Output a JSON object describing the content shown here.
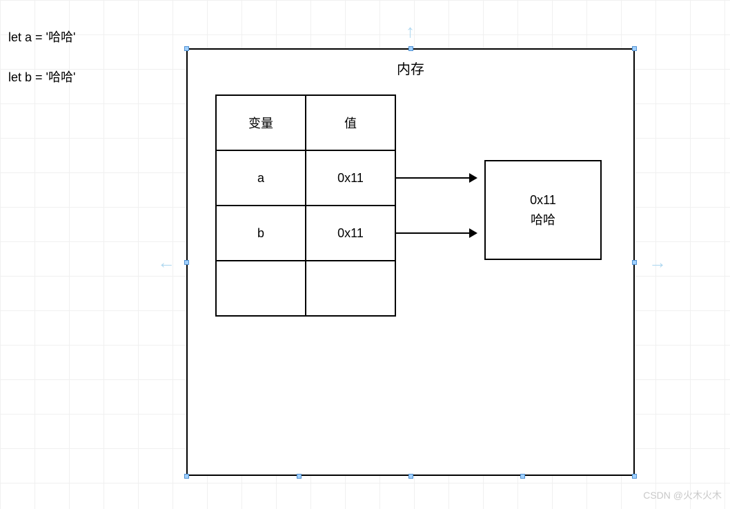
{
  "code": {
    "line1": "let a = '哈哈'",
    "line2": "let b = '哈哈'"
  },
  "memory": {
    "title": "内存",
    "table": {
      "header_var": "变量",
      "header_val": "值",
      "rows": [
        {
          "var": "a",
          "val": "0x11"
        },
        {
          "var": "b",
          "val": "0x11"
        },
        {
          "var": "",
          "val": ""
        }
      ]
    },
    "heap": {
      "address": "0x11",
      "value": "哈哈"
    }
  },
  "watermark": "CSDN @火木火木"
}
